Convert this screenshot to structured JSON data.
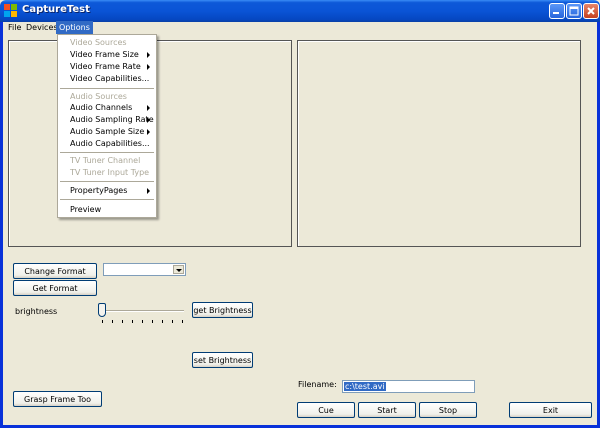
{
  "window": {
    "title": "CaptureTest"
  },
  "menubar": {
    "items": [
      "File",
      "Devices",
      "Options"
    ],
    "active": "Options"
  },
  "options_menu": {
    "items": [
      {
        "label": "Video Sources",
        "enabled": false,
        "submenu": false
      },
      {
        "label": "Video Frame Size",
        "enabled": true,
        "submenu": true
      },
      {
        "label": "Video Frame Rate",
        "enabled": true,
        "submenu": true
      },
      {
        "label": "Video Capabilities...",
        "enabled": true,
        "submenu": false
      },
      {
        "label": "Audio Sources",
        "enabled": false,
        "submenu": false
      },
      {
        "label": "Audio Channels",
        "enabled": true,
        "submenu": true
      },
      {
        "label": "Audio Sampling Rate",
        "enabled": true,
        "submenu": true
      },
      {
        "label": "Audio Sample Size",
        "enabled": true,
        "submenu": true
      },
      {
        "label": "Audio Capabilities...",
        "enabled": true,
        "submenu": false
      },
      {
        "label": "TV Tuner Channel",
        "enabled": false,
        "submenu": false
      },
      {
        "label": "TV Tuner Input Type",
        "enabled": false,
        "submenu": false
      },
      {
        "label": "PropertyPages",
        "enabled": true,
        "submenu": true
      },
      {
        "label": "Preview",
        "enabled": true,
        "submenu": false
      }
    ]
  },
  "controls": {
    "change_format": "Change Format",
    "get_format": "Get Format",
    "brightness_label": "brightness",
    "get_brightness": "get Brightness",
    "set_brightness": "set Brightness",
    "grasp_frame": "Grasp Frame Too",
    "filename_label": "Filename:",
    "filename_value": "c:\\test.avi",
    "cue": "Cue",
    "start": "Start",
    "stop": "Stop",
    "exit": "Exit",
    "format_combo_value": ""
  }
}
